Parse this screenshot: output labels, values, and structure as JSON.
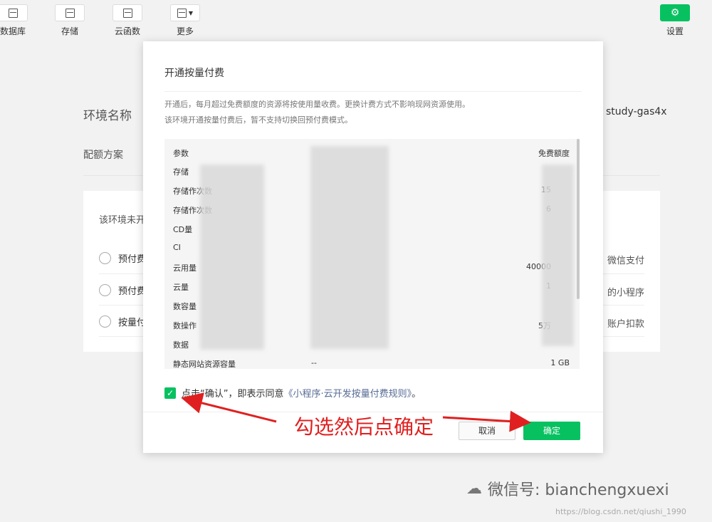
{
  "toolbar": {
    "items": [
      {
        "label": "数据库",
        "icon": "database-icon"
      },
      {
        "label": "存储",
        "icon": "save-icon"
      },
      {
        "label": "云函数",
        "icon": "function-icon"
      },
      {
        "label": "更多",
        "icon": "layers-icon"
      }
    ],
    "settings_label": "设置"
  },
  "background": {
    "env_label": "环境名称",
    "env_value": "study-gas4x",
    "quota_label": "配额方案",
    "notice": "该环境未开",
    "options": [
      {
        "label": "预付费",
        "right": "微信支付"
      },
      {
        "label": "预付费",
        "right": "的小程序"
      },
      {
        "label": "按量付",
        "right": "账户扣款"
      }
    ]
  },
  "modal": {
    "title": "开通按量付费",
    "desc1": "开通后，每月超过免费额度的资源将按使用量收费。更换计费方式不影响现网资源使用。",
    "desc2": "该环境开通按量付费后，暂不支持切换回预付费模式。",
    "table": {
      "headers": {
        "param": "参数",
        "free": "免费额度"
      },
      "rows": [
        {
          "param": "存储",
          "free": ""
        },
        {
          "param": "存储作次数",
          "free": "15"
        },
        {
          "param": "存储作次数",
          "free": "6"
        },
        {
          "param": "CD量",
          "free": ""
        },
        {
          "param": "CI",
          "free": ""
        },
        {
          "param": "云用量",
          "free": "40000"
        },
        {
          "param": "云量",
          "free": "1"
        },
        {
          "param": "数容量",
          "free": ""
        },
        {
          "param": "数操作",
          "free": "5万"
        },
        {
          "param": "数据",
          "free": ""
        },
        {
          "param": "静态网站资源容量",
          "mid": "--",
          "free": "1 GB"
        }
      ]
    },
    "agree_prefix": "点击“确认”，即表示同意",
    "agree_link": "《小程序·云开发按量付费规则》",
    "agree_suffix": "。",
    "cancel_label": "取消",
    "ok_label": "确定"
  },
  "annotation": "勾选然后点确定",
  "watermark": "微信号: bianchengxuexi",
  "csdn": "https://blog.csdn.net/qiushi_1990",
  "colors": {
    "accent": "#07c160",
    "annotation": "#e02020",
    "link": "#576b95"
  }
}
